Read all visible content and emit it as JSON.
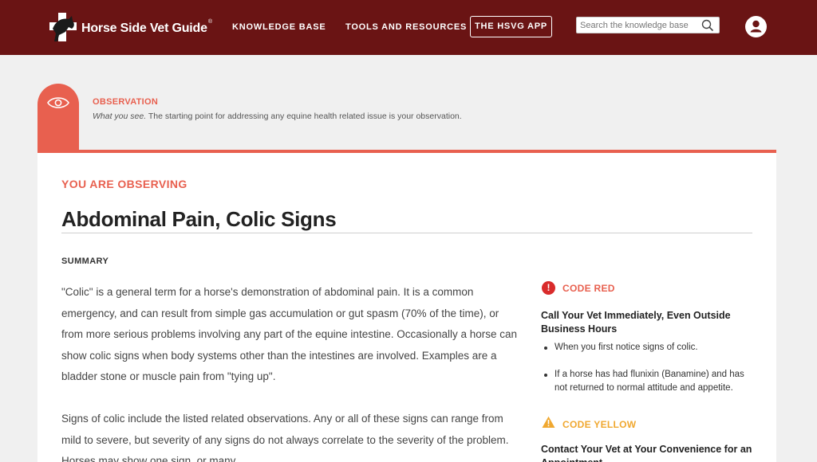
{
  "header": {
    "brand": "Horse Side Vet Guide",
    "brand_reg": "®",
    "nav": {
      "knowledge_base": "KNOWLEDGE BASE",
      "tools": "TOOLS AND RESOURCES",
      "app": "THE HSVG APP"
    },
    "search": {
      "placeholder": "Search the knowledge base"
    },
    "icons": {
      "logo": "horse-cross-logo-icon",
      "search": "search-icon",
      "user": "user-icon"
    }
  },
  "observation": {
    "icon": "eye-icon",
    "title": "OBSERVATION",
    "desc_em": "What you see.",
    "desc_rest": " The starting point for addressing any equine health related issue is your observation."
  },
  "main": {
    "kicker": "YOU ARE OBSERVING",
    "title": "Abdominal Pain, Colic Signs",
    "summary_label": "SUMMARY",
    "paragraphs": [
      "\"Colic\" is a general term for a horse's demonstration of abdominal pain. It is a common emergency, and can result from simple gas accumulation or gut spasm (70% of the time), or from more serious problems involving any part of the equine intestine. Occasionally a horse can show colic signs when body systems other than the intestines are involved. Examples are a bladder stone or muscle pain from \"tying up\".",
      "Signs of colic include the listed related observations. Any or all of these signs can range from mild to severe, but severity of any signs do not always correlate to the severity of the problem. Horses may show one sign, or many."
    ]
  },
  "codes": {
    "red": {
      "label": "CODE RED",
      "subtitle": "Call Your Vet Immediately, Even Outside Business Hours",
      "bullets": [
        "When you first notice signs of colic.",
        "If a horse has had flunixin (Banamine) and has not returned to normal attitude and appetite."
      ],
      "color": "#d92b2b"
    },
    "yellow": {
      "label": "CODE YELLOW",
      "subtitle": "Contact Your Vet at Your Convenience for an Appointment",
      "color": "#f0a830"
    }
  },
  "colors": {
    "header_bg": "#6a1414",
    "accent": "#e8604f"
  }
}
